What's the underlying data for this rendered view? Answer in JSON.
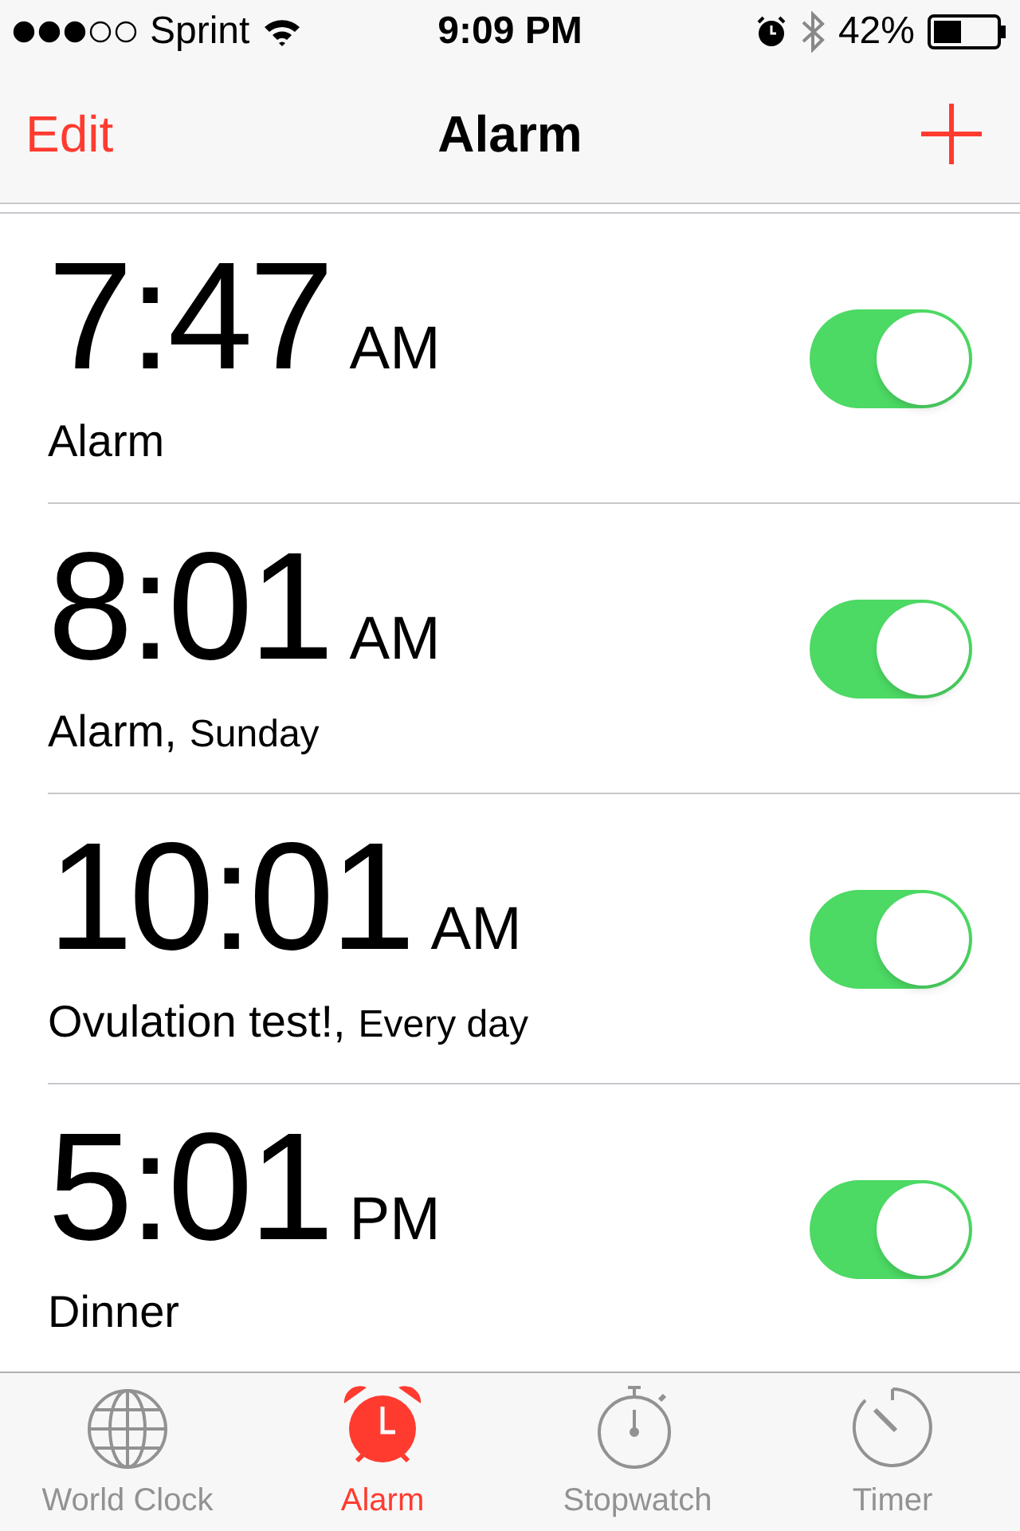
{
  "status_bar": {
    "carrier": "Sprint",
    "time": "9:09 PM",
    "battery": "42%"
  },
  "nav": {
    "edit": "Edit",
    "title": "Alarm"
  },
  "alarms": [
    {
      "time": "7:47",
      "period": "AM",
      "label": "Alarm",
      "on": true
    },
    {
      "time": "8:01",
      "period": "AM",
      "label": "Alarm,",
      "repeat": "Sunday",
      "on": true
    },
    {
      "time": "10:01",
      "period": "AM",
      "label": "Ovulation test!,",
      "repeat": "Every day",
      "on": true
    },
    {
      "time": "5:01",
      "period": "PM",
      "label": "Dinner",
      "on": true
    }
  ],
  "tabs": [
    {
      "label": "World Clock",
      "kind": "globe",
      "selected": false
    },
    {
      "label": "Alarm",
      "kind": "alarm",
      "selected": true
    },
    {
      "label": "Stopwatch",
      "kind": "stopwatch",
      "selected": false
    },
    {
      "label": "Timer",
      "kind": "timer",
      "selected": false
    }
  ]
}
